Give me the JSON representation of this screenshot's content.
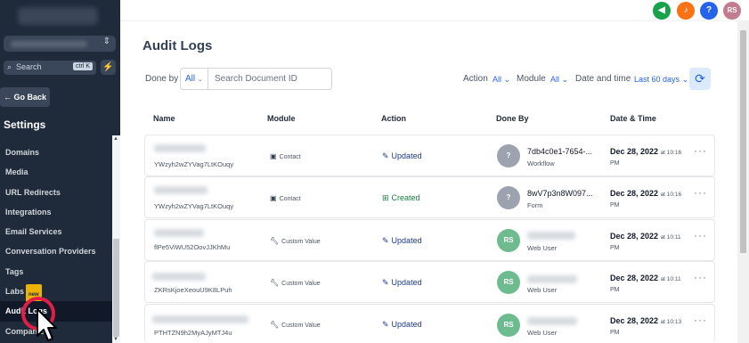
{
  "sidebar": {
    "search_placeholder": "Search",
    "search_shortcut": "ctrl K",
    "go_back": "Go Back",
    "settings_title": "Settings",
    "items": [
      {
        "label": "Domains"
      },
      {
        "label": "Media"
      },
      {
        "label": "URL Redirects"
      },
      {
        "label": "Integrations"
      },
      {
        "label": "Email Services"
      },
      {
        "label": "Conversation Providers"
      },
      {
        "label": "Tags"
      },
      {
        "label": "Labs",
        "badge": "new"
      },
      {
        "label": "Audit Logs",
        "active": true
      },
      {
        "label": "Companies"
      }
    ]
  },
  "topbar": {
    "avatar_initials": "RS",
    "help": "?",
    "colors": {
      "megaphone": "#16a34a",
      "bell": "#f97316",
      "help": "#2563eb",
      "avatar": "#c27b8f"
    }
  },
  "page": {
    "title": "Audit Logs",
    "filters": {
      "done_by_label": "Done by",
      "done_by_value": "All",
      "search_placeholder": "Search Document ID",
      "action_label": "Action",
      "action_value": "All",
      "module_label": "Module",
      "module_value": "All",
      "date_label": "Date and time",
      "date_value": "Last 60 days"
    },
    "columns": [
      "Name",
      "Module",
      "Action",
      "Done By",
      "Date & Time"
    ]
  },
  "rows": [
    {
      "doc_id": "YWzyh2wZYVag7LtKOuqy",
      "module": "Contact",
      "module_icon": "contact-card-icon",
      "action": "Updated",
      "done_by_avatar": "?",
      "done_by_name": "7db4c0e1-7654-...",
      "done_by_type": "Workflow",
      "date": "Dec 28, 2022",
      "at": "at",
      "time": "10:16",
      "ampm": "PM"
    },
    {
      "doc_id": "YWzyh2wZYVag7LtKOuqy",
      "module": "Contact",
      "module_icon": "contact-card-icon",
      "action": "Created",
      "done_by_avatar": "?",
      "done_by_name": "8wV7p3n8W097...",
      "done_by_type": "Form",
      "date": "Dec 28, 2022",
      "at": "at",
      "time": "10:16",
      "ampm": "PM"
    },
    {
      "doc_id": "flPe5ViWU52OovJJKhMu",
      "module": "Custom Value",
      "module_icon": "wrench-icon",
      "action": "Updated",
      "done_by_avatar": "RS",
      "done_by_name": "",
      "done_by_type": "Web User",
      "date": "Dec 28, 2022",
      "at": "at",
      "time": "10:11",
      "ampm": "PM"
    },
    {
      "doc_id": "ZKRsKjoeXeouU9K8LPuh",
      "module": "Custom Value",
      "module_icon": "wrench-icon",
      "action": "Updated",
      "done_by_avatar": "RS",
      "done_by_name": "",
      "done_by_type": "Web User",
      "date": "Dec 28, 2022",
      "at": "at",
      "time": "10:11",
      "ampm": "PM"
    },
    {
      "doc_id": "PTHTZN9h2MyAJyMTJ4u",
      "module": "Custom Value",
      "module_icon": "wrench-icon",
      "action": "Updated",
      "done_by_avatar": "RS",
      "done_by_name": "",
      "done_by_type": "Web User",
      "date": "Dec 28, 2022",
      "at": "at",
      "time": "10:13",
      "ampm": "PM"
    }
  ]
}
